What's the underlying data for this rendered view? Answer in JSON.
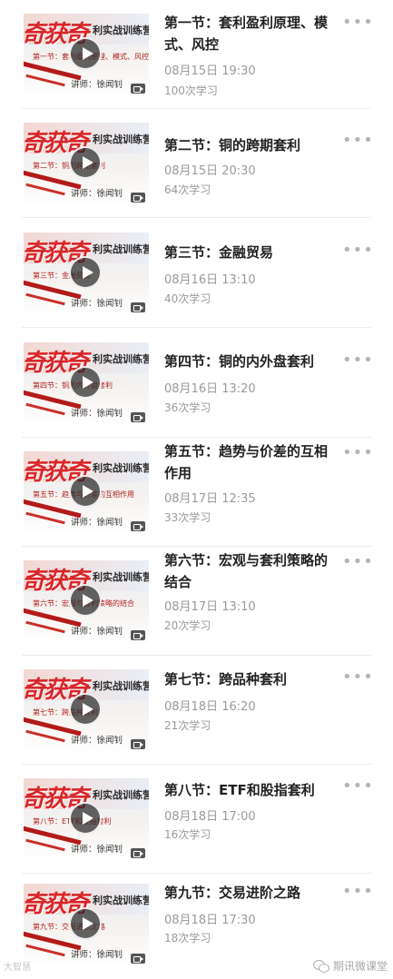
{
  "thumbnail": {
    "brand": "奇获奇",
    "banner": "利实战训练营",
    "lecturer": "讲师：徐闻钊"
  },
  "lessons": [
    {
      "title": "第一节：套利盈利原理、模式、风控",
      "date": "08月15日 19:30",
      "count": "100次学习",
      "thumb_sub": "第一节：套利盈利原理、模式、风控"
    },
    {
      "title": "第二节：铜的跨期套利",
      "date": "08月15日 20:30",
      "count": "64次学习",
      "thumb_sub": "第二节：铜的跨期套利"
    },
    {
      "title": "第三节：金融贸易",
      "date": "08月16日 13:10",
      "count": "40次学习",
      "thumb_sub": "第三节：金融贸易"
    },
    {
      "title": "第四节：铜的内外盘套利",
      "date": "08月16日 13:20",
      "count": "36次学习",
      "thumb_sub": "第四节：铜的内外盘套利"
    },
    {
      "title": "第五节：趋势与价差的互相作用",
      "date": "08月17日 12:35",
      "count": "33次学习",
      "thumb_sub": "第五节：趋势与价差的互相作用"
    },
    {
      "title": "第六节：宏观与套利策略的结合",
      "date": "08月17日 13:10",
      "count": "20次学习",
      "thumb_sub": "第六节：宏观与套利策略的结合"
    },
    {
      "title": "第七节：跨品种套利",
      "date": "08月18日 16:20",
      "count": "21次学习",
      "thumb_sub": "第七节：跨品种套利"
    },
    {
      "title": "第八节：ETF和股指套利",
      "date": "08月18日 17:00",
      "count": "16次学习",
      "thumb_sub": "第八节：ETF和股指套利"
    },
    {
      "title": "第九节：交易进阶之路",
      "date": "08月18日 17:30",
      "count": "18次学习",
      "thumb_sub": "第九节：交易进阶之路"
    }
  ],
  "more_label": "•••",
  "watermark_left": "大智慧",
  "watermark_right": "期讯微课堂"
}
